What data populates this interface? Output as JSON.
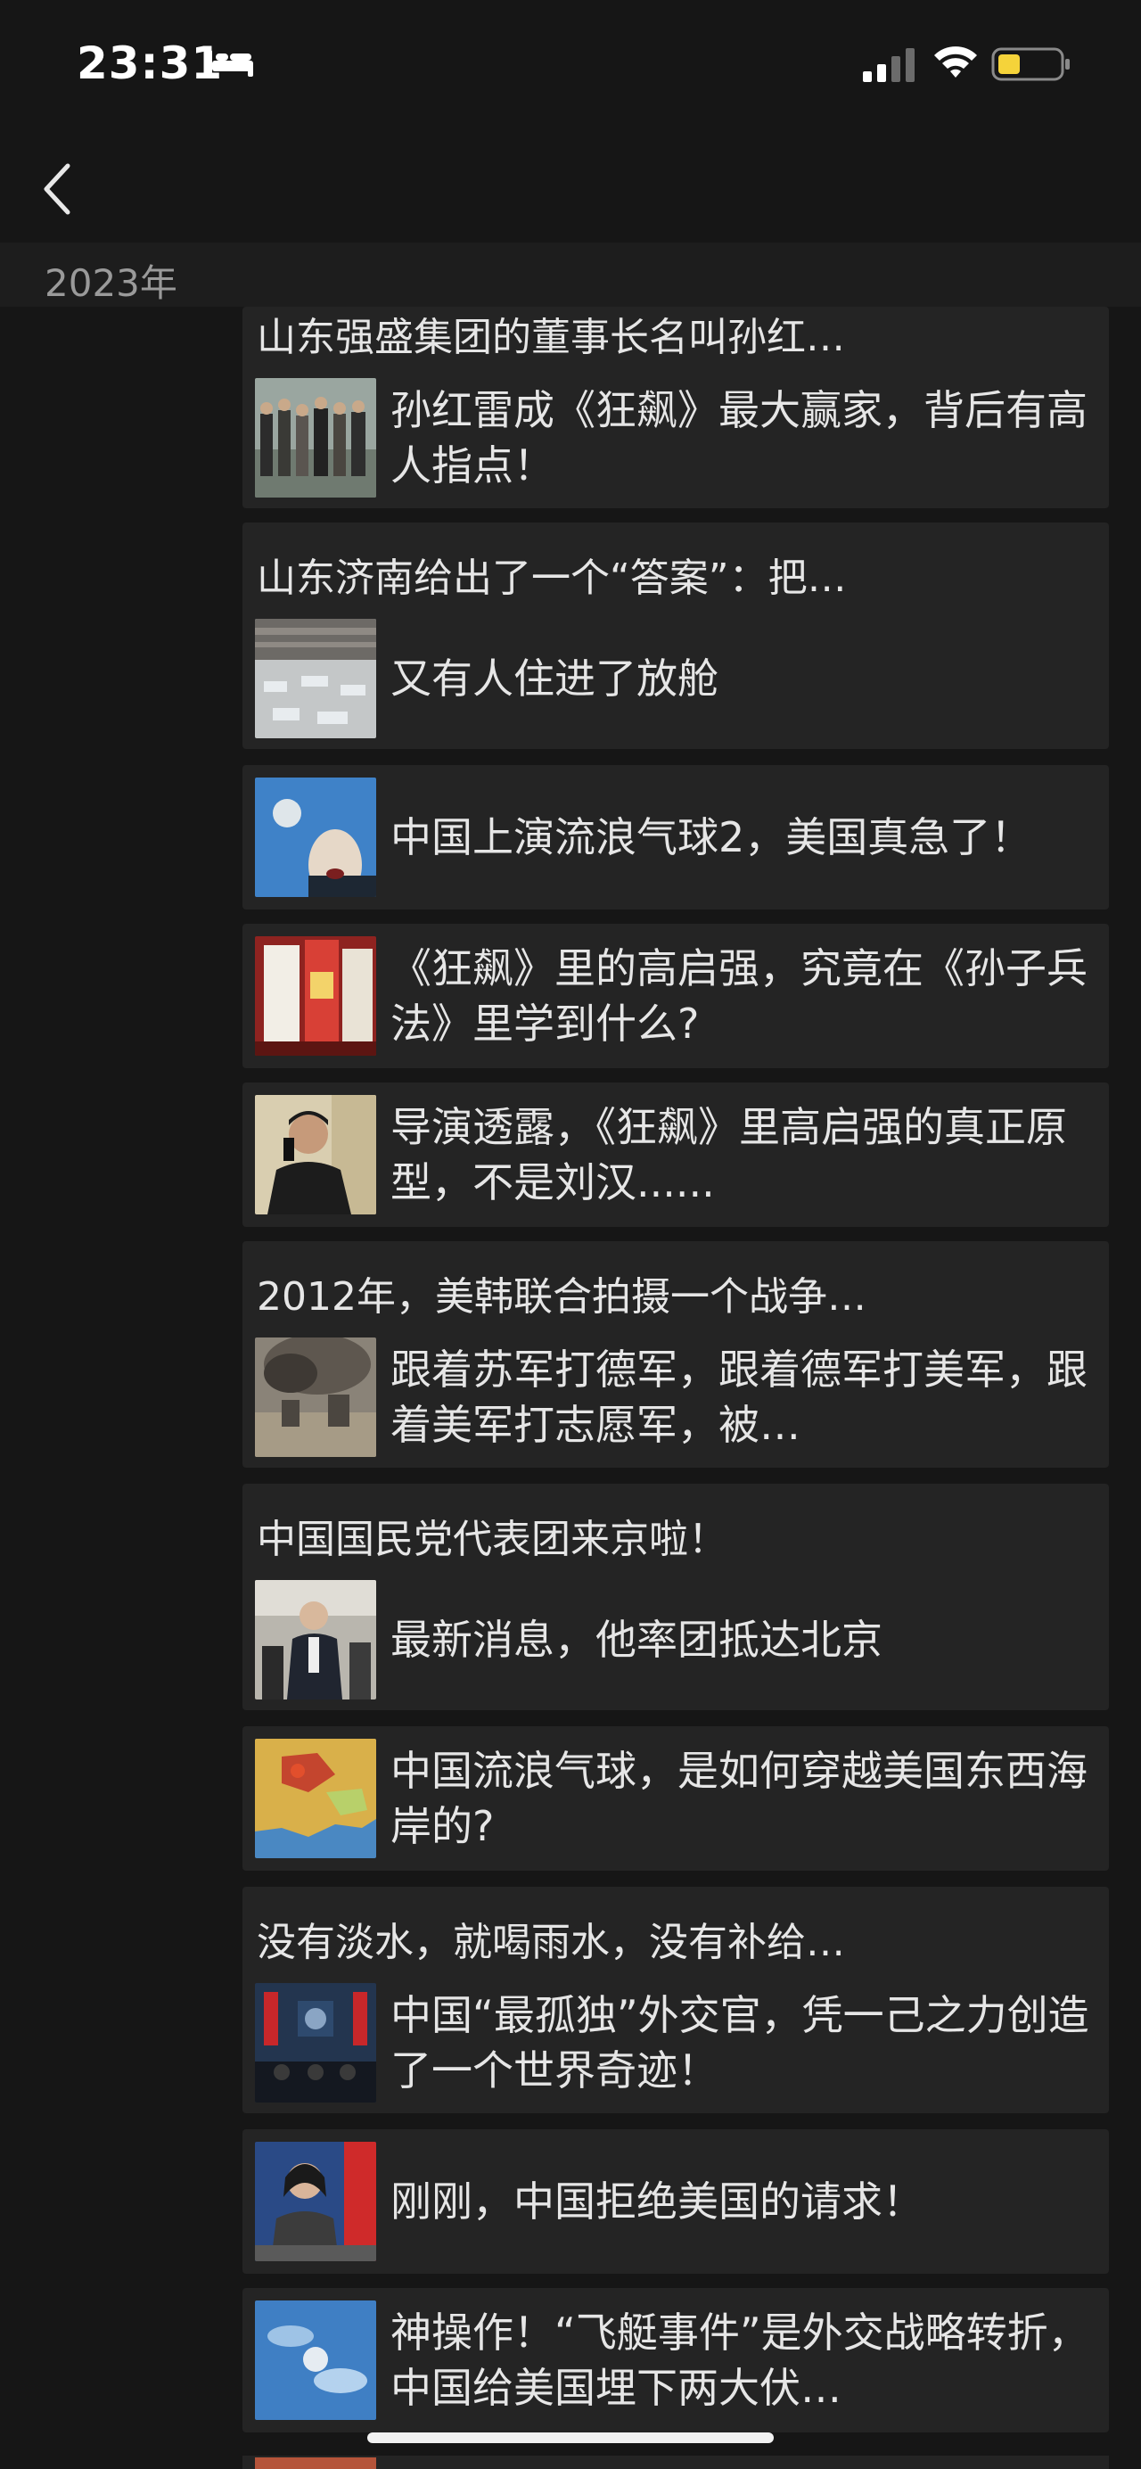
{
  "status_bar": {
    "time": "23:31",
    "icons": [
      "bed-icon",
      "cellular-signal-icon",
      "wifi-icon",
      "battery-low-icon"
    ]
  },
  "nav": {
    "back_icon": "chevron-left-icon"
  },
  "section": {
    "year": "2023年"
  },
  "items": [
    {
      "title": "山东强盛集团的董事长名叫孙红…",
      "text": "孙红雷成《狂飙》最大赢家，背后有高人指点！"
    },
    {
      "title": "山东济南给出了一个“答案”：把…",
      "text": "又有人住进了放舱"
    },
    {
      "title": "",
      "text": "中国上演流浪气球2，美国真急了！"
    },
    {
      "title": "",
      "text": "《狂飙》里的高启强，究竟在《孙子兵法》里学到什么?"
    },
    {
      "title": "",
      "text": "导演透露，《狂飙》里高启强的真正原型，不是刘汉......"
    },
    {
      "title": "2012年，美韩联合拍摄一个战争…",
      "text": "跟着苏军打德军，跟着德军打美军，跟着美军打志愿军，被…"
    },
    {
      "title": "中国国民党代表团来京啦！",
      "text": "最新消息，他率团抵达北京"
    },
    {
      "title": "",
      "text": "中国流浪气球，是如何穿越美国东西海岸的?"
    },
    {
      "title": "没有淡水，就喝雨水，没有补给…",
      "text": "中国“最孤独”外交官，凭一己之力创造了一个世界奇迹！"
    },
    {
      "title": "",
      "text": "刚刚，中国拒绝美国的请求！"
    },
    {
      "title": "",
      "text": "神操作！“飞艇事件”是外交战略转折，中国给美国埋下两大伏…"
    }
  ]
}
